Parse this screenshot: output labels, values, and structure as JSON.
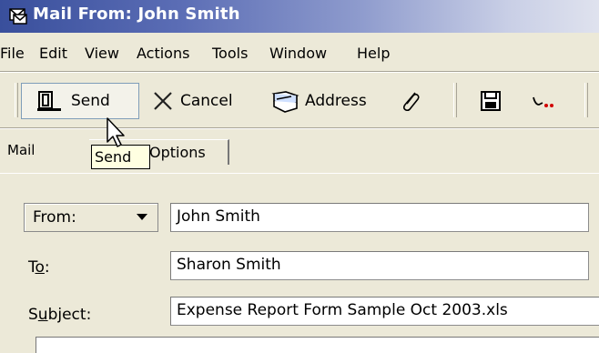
{
  "window": {
    "title": "Mail From: John Smith"
  },
  "menu": [
    "File",
    "Edit",
    "View",
    "Actions",
    "Tools",
    "Window",
    "Help"
  ],
  "toolbar": {
    "send_label": "Send",
    "cancel_label": "Cancel",
    "address_label": "Address",
    "icons": [
      "send-icon",
      "cancel-icon",
      "address-book-icon",
      "attachment-icon",
      "save-icon",
      "signature-icon"
    ]
  },
  "tabs": {
    "mail": "Mail",
    "options": "Options"
  },
  "tooltip": "Send",
  "form": {
    "from_label": "From:",
    "from_value": "John Smith",
    "to_label_pre": "T",
    "to_label_acc": "o",
    "to_label_post": ":",
    "to_value": "Sharon Smith",
    "subject_label_pre": "S",
    "subject_label_acc": "u",
    "subject_label_post": "bject:",
    "subject_value": "Expense Report Form Sample Oct 2003.xls"
  },
  "colors": {
    "title_start": "#394f9c",
    "chrome": "#ece9d8",
    "tooltip": "#ffffe1"
  }
}
